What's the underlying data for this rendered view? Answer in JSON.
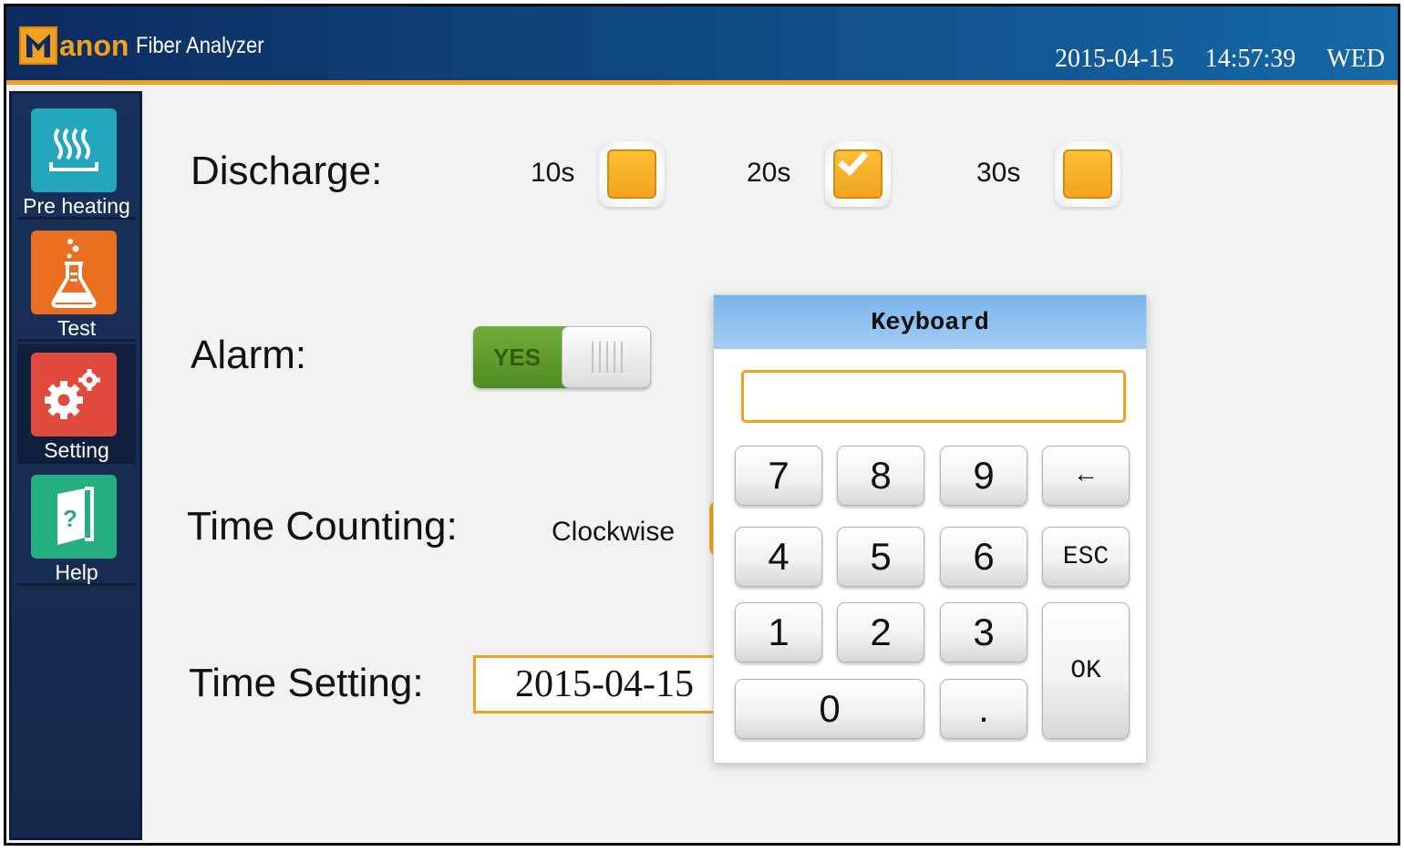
{
  "header": {
    "logo_text": "anon",
    "app_title": "Fiber Analyzer",
    "date": "2015-04-15",
    "time": "14:57:39",
    "weekday": "WED"
  },
  "sidebar": {
    "items": [
      {
        "label": "Pre heating",
        "icon": "heating-icon",
        "color": "#24a7bd"
      },
      {
        "label": "Test",
        "icon": "flask-icon",
        "color": "#ea6e1f"
      },
      {
        "label": "Setting",
        "icon": "gears-icon",
        "color": "#e04a3c",
        "active": true
      },
      {
        "label": "Help",
        "icon": "help-book-icon",
        "color": "#25ae7e"
      }
    ]
  },
  "settings": {
    "discharge": {
      "label": "Discharge:",
      "options": [
        {
          "label": "10s",
          "checked": false
        },
        {
          "label": "20s",
          "checked": true
        },
        {
          "label": "30s",
          "checked": false
        }
      ]
    },
    "alarm": {
      "label": "Alarm:",
      "toggle_text": "YES",
      "on": true
    },
    "time_counting": {
      "label": "Time Counting:",
      "option_label": "Clockwise"
    },
    "time_setting": {
      "label": "Time Setting:",
      "value": "2015-04-15"
    }
  },
  "keyboard": {
    "title": "Keyboard",
    "input_value": "",
    "keys": {
      "k7": "7",
      "k8": "8",
      "k9": "9",
      "backspace": "←",
      "k4": "4",
      "k5": "5",
      "k6": "6",
      "esc": "ESC",
      "k1": "1",
      "k2": "2",
      "k3": "3",
      "ok": "OK",
      "k0": "0",
      "dot": "."
    }
  },
  "colors": {
    "accent": "#f0a21e",
    "header_bg": "#0f4d87",
    "toggle_on": "#5e9a2b",
    "keyboard_title_bg": "#8fc1ef"
  }
}
